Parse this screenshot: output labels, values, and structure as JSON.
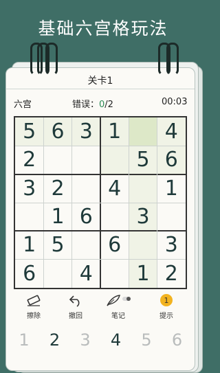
{
  "header_title": "基础六宫格玩法",
  "level_label": "关卡1",
  "mode_label": "六宫",
  "errors_label": "错误：",
  "errors_current": "0",
  "errors_sep_total": "/2",
  "timer": "00:03",
  "colors": {
    "background": "#3f6e66",
    "highlight": "#f0f3e6",
    "selected": "#dde8c8",
    "accent": "#2e8b57"
  },
  "grid": [
    [
      "5",
      "6",
      "3",
      "1",
      "",
      "4"
    ],
    [
      "2",
      "",
      "",
      "",
      "5",
      "6"
    ],
    [
      "3",
      "2",
      "",
      "4",
      "",
      "1"
    ],
    [
      "",
      "1",
      "6",
      "",
      "3",
      ""
    ],
    [
      "1",
      "5",
      "",
      "6",
      "",
      "3"
    ],
    [
      "6",
      "",
      "4",
      "",
      "1",
      "2"
    ]
  ],
  "tools": [
    {
      "label": "擦除",
      "icon": "eraser-icon"
    },
    {
      "label": "撤回",
      "icon": "undo-icon"
    },
    {
      "label": "笔记",
      "icon": "feather-pen-icon"
    },
    {
      "label": "提示",
      "icon": "lightbulb-icon",
      "badge": "1"
    }
  ],
  "number_pad": [
    "1",
    "2",
    "3",
    "4",
    "5",
    "6"
  ]
}
